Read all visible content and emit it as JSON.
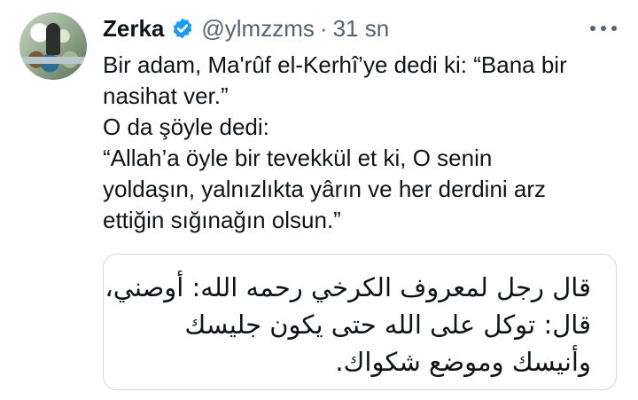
{
  "tweet": {
    "author_name": "Zerka",
    "verified_icon": "verified-badge-icon",
    "handle": "@ylmzzms",
    "separator": "·",
    "time": "31 sn",
    "more_icon": "more-options-icon",
    "accent_color": "#1d9bf0",
    "body_lines": [
      "Bir adam, Ma'rûf el-Kerhî’ye dedi ki: “Bana bir",
      "nasihat ver.”",
      "O da şöyle dedi:",
      "“Allah’a öyle bir tevekkül et ki, O senin",
      "yoldaşın, yalnızlıkta yârın ve her derdini arz",
      "ettiğin sığınağın olsun.”"
    ],
    "quoted_lines": [
      "قال رجل لمعروف الكرخي رحمه الله: أوصني،",
      "قال: توكل على الله حتى يكون جليسك",
      "وأنيسك وموضع شكواك."
    ]
  }
}
